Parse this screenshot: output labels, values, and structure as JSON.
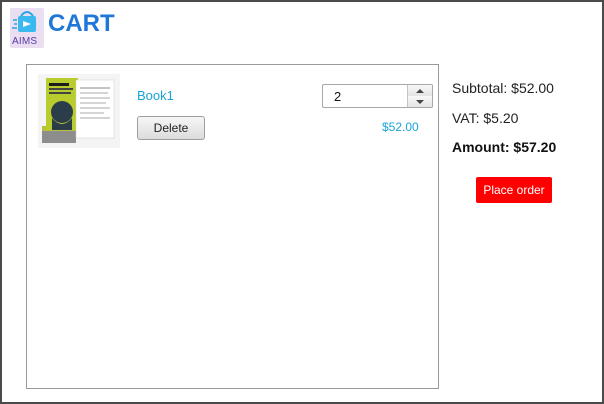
{
  "header": {
    "logo_text": "AIMS",
    "title": "CART"
  },
  "cart": {
    "items": [
      {
        "name": "Book1",
        "delete_label": "Delete",
        "quantity": "2",
        "price": "$52.00",
        "image_icon": "book-cover-image"
      }
    ]
  },
  "summary": {
    "subtotal": "Subtotal: $52.00",
    "vat": "VAT: $5.20",
    "amount": "Amount: $57.20",
    "place_order_label": "Place order"
  },
  "colors": {
    "title": "#1f78d8",
    "link_blue": "#1aa3d9",
    "place_order_bg": "#ff0000"
  }
}
